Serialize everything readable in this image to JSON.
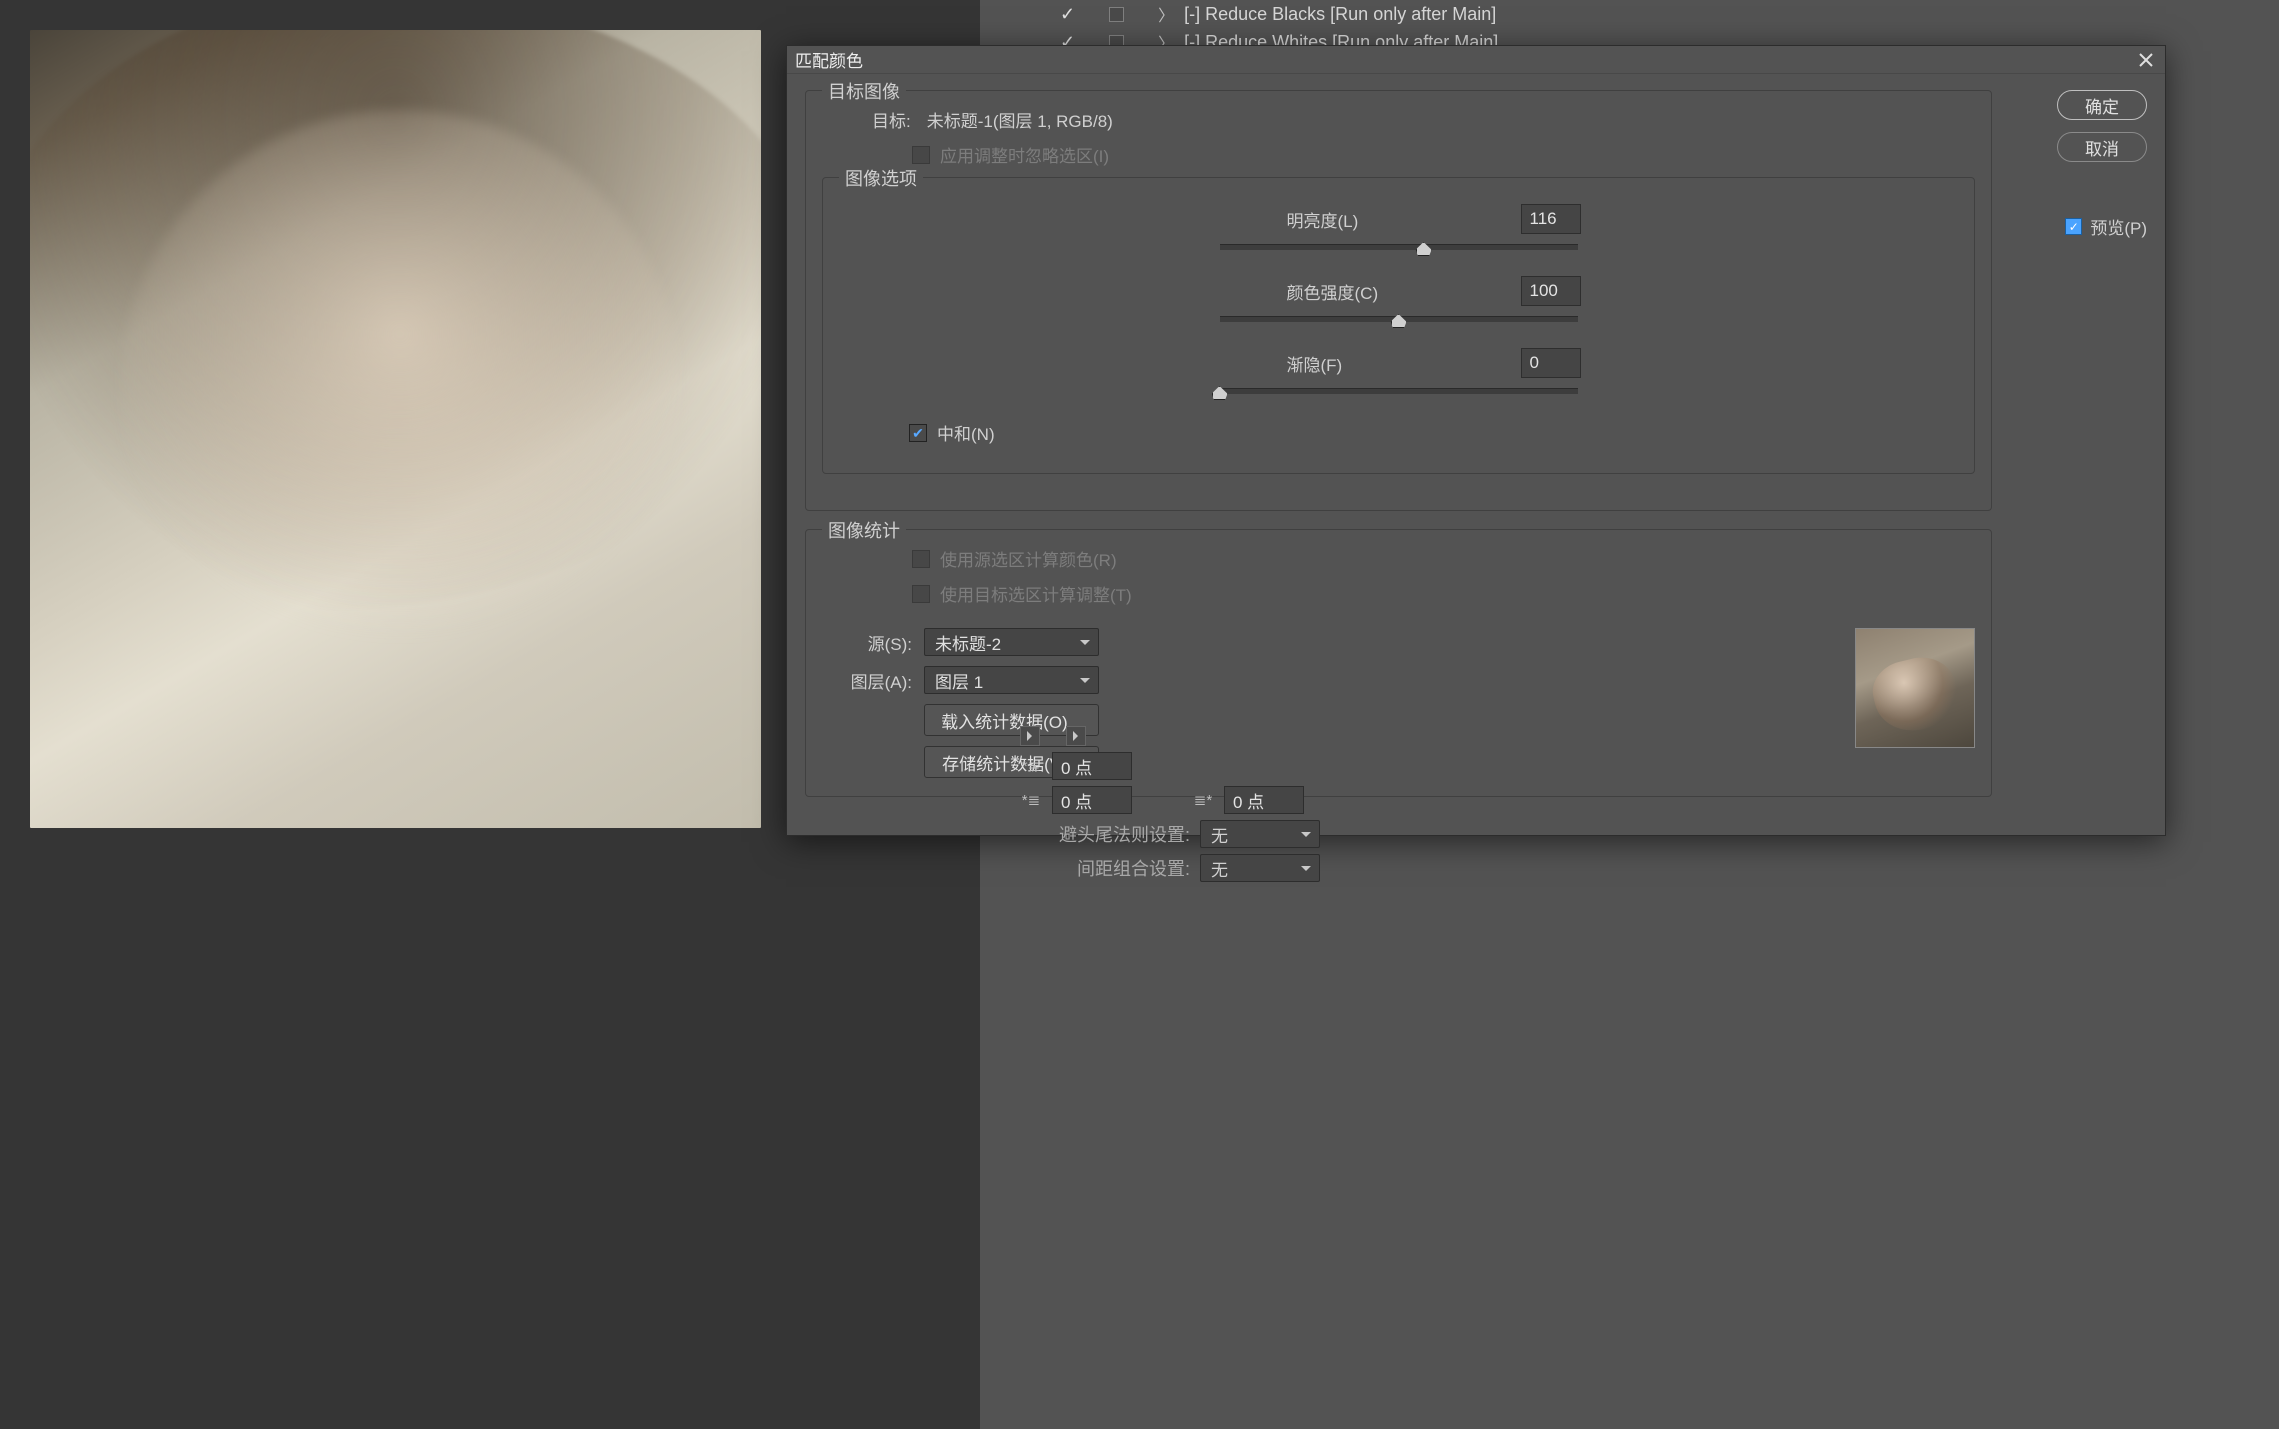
{
  "background_panel": {
    "rows": [
      "[-] Reduce Blacks [Run only after Main]",
      "[-] Reduce Whites [Run only after Main]"
    ]
  },
  "dialog": {
    "title": "匹配颜色",
    "buttons": {
      "ok": "确定",
      "cancel": "取消"
    },
    "preview": {
      "label": "预览(P)",
      "checked": true
    },
    "target_image": {
      "legend": "目标图像",
      "target_label": "目标:",
      "target_value": "未标题-1(图层 1, RGB/8)",
      "ignore_sel": {
        "label": "应用调整时忽略选区(I)",
        "checked": false,
        "enabled": false
      }
    },
    "image_options": {
      "legend": "图像选项",
      "luminance": {
        "label": "明亮度(L)",
        "value": "116",
        "thumb_pct": 57
      },
      "intensity": {
        "label": "颜色强度(C)",
        "value": "100",
        "thumb_pct": 50
      },
      "fade": {
        "label": "渐隐(F)",
        "value": "0",
        "thumb_pct": 0
      },
      "neutralize": {
        "label": "中和(N)",
        "checked": true
      }
    },
    "image_stats": {
      "legend": "图像统计",
      "use_source_sel": {
        "label": "使用源选区计算颜色(R)",
        "enabled": false
      },
      "use_target_sel": {
        "label": "使用目标选区计算调整(T)",
        "enabled": false
      },
      "source": {
        "label": "源(S):",
        "value": "未标题-2"
      },
      "layer": {
        "label": "图层(A):",
        "value": "图层 1"
      },
      "load_stats": "载入统计数据(O)...",
      "save_stats": "存储统计数据(V)..."
    }
  },
  "bottom_panel": {
    "row1_value": "0 点",
    "row2_left_value": "0 点",
    "row2_right_value": "0 点",
    "hyphen_label": "避头尾法则设置:",
    "hyphen_value": "无",
    "spacing_label": "间距组合设置:",
    "spacing_value": "无"
  }
}
